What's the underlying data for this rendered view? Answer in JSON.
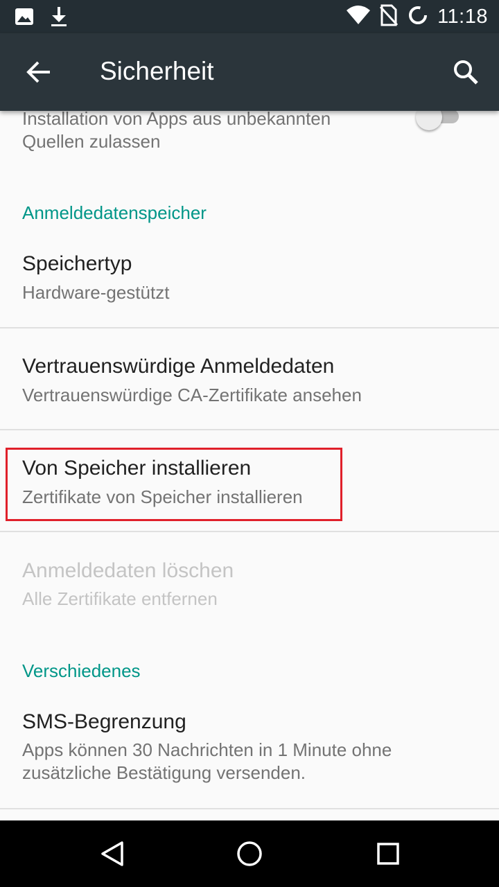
{
  "status_bar": {
    "time": "11:18",
    "icons_left": [
      "image-icon",
      "download-icon"
    ],
    "icons_right": [
      "wifi-icon",
      "no-sim-icon",
      "sync-icon"
    ]
  },
  "app_bar": {
    "title": "Sicherheit",
    "back_icon": "arrow-back-icon",
    "search_icon": "search-icon"
  },
  "unknown_sources": {
    "summary": "Installation von Apps aus unbekannten Quellen zulassen",
    "toggle_on": false
  },
  "sections": {
    "credentials_header": "Anmeldedatenspeicher",
    "misc_header": "Verschiedenes"
  },
  "items": [
    {
      "title": "Speichertyp",
      "summary": "Hardware-gestützt",
      "enabled": true
    },
    {
      "title": "Vertrauenswürdige Anmeldedaten",
      "summary": "Vertrauenswürdige CA-Zertifikate ansehen",
      "enabled": true
    },
    {
      "title": "Von Speicher installieren",
      "summary": "Zertifikate von Speicher installieren",
      "enabled": true,
      "highlighted": true
    },
    {
      "title": "Anmeldedaten löschen",
      "summary": "Alle Zertifikate entfernen",
      "enabled": false
    },
    {
      "title": "SMS-Begrenzung",
      "summary": "Apps können 30 Nachrichten in 1 Minute ohne zusätzliche Bestätigung versenden.",
      "enabled": true
    }
  ],
  "colors": {
    "accent": "#009688",
    "appbar": "#2b353b",
    "statusbar": "#242e34",
    "highlight_box": "#e0202a"
  },
  "nav_bar": {
    "icons": [
      "back-triangle-icon",
      "home-circle-icon",
      "recents-square-icon"
    ]
  }
}
